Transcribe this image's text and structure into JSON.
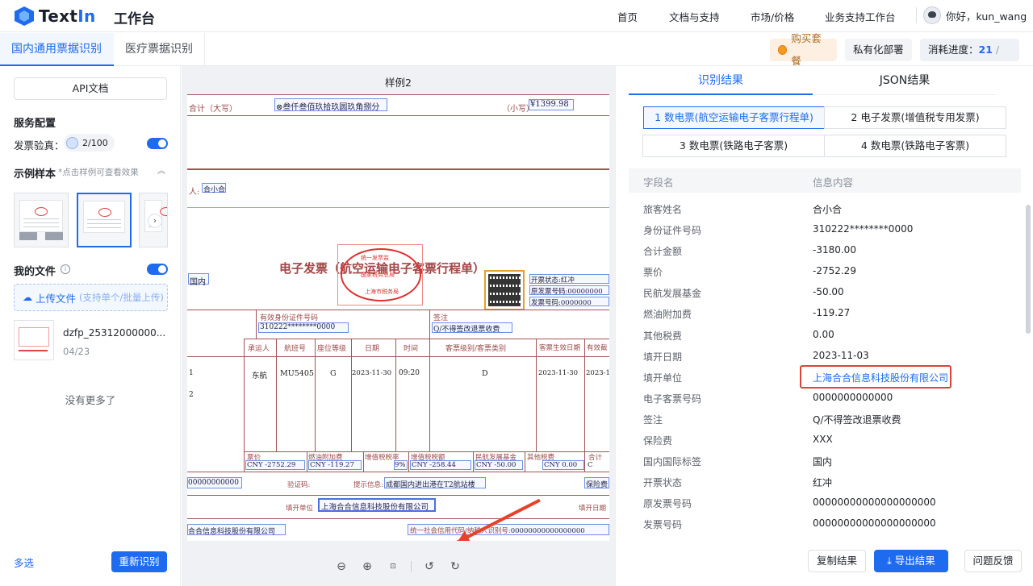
{
  "header": {
    "logo_text": "TextIn",
    "logo_text_main": "Text",
    "logo_text_accent": "In",
    "workbench": "工作台",
    "nav": [
      "首页",
      "文档与支持",
      "市场/价格",
      "业务支持工作台"
    ],
    "user_greeting": "你好，kun_wang"
  },
  "tabs": {
    "active": "国内通用票据识别",
    "second": "医疗票据识别",
    "buy_label": "购买套餐",
    "private_label": "私有化部署",
    "usage_label": "消耗进度：",
    "usage_used": "21",
    "usage_total": "/ 100"
  },
  "sidebar": {
    "api_doc": "API文档",
    "service_config": "服务配置",
    "invoice_verify": "发票验真：",
    "verify_quota": "2/100",
    "samples_title": "示例样本",
    "samples_hint": "*点击样例可查看效果",
    "my_files": "我的文件",
    "upload_main": "上传文件",
    "upload_sub": "(支持单个/批量上传)",
    "file_name": "dzfp_25312000000...",
    "file_date": "04/23",
    "no_more": "没有更多了",
    "multi_select": "多选",
    "reparse": "重新识别"
  },
  "preview": {
    "title": "样例2",
    "paper": {
      "total_upper_label": "合计（大写）",
      "total_upper_value": "叁仟叁佰玖拾玖圆玖角捌分",
      "total_lower_label": "（小写）",
      "total_lower_value": "¥1399.98",
      "passenger_prefix": "人:",
      "passenger": "合小合",
      "doc_title": "电子发票（航空运输电子客票行程单）",
      "domestic": "国内",
      "status_label": "开票状态:",
      "status": "红冲",
      "orig_no_label": "原发票号码:",
      "orig_no": "00000000",
      "inv_no_label": "发票号码:",
      "inv_no": "0000000",
      "id_label": "有效身份证件号码",
      "id_value": "310222********0000",
      "note_label": "签注",
      "note_value": "Q/不得签改退票收费",
      "cols": [
        "承运人",
        "航班号",
        "座位等级",
        "日期",
        "时间",
        "客票级别/客票类别",
        "客票生效日期",
        "有效截"
      ],
      "row1_idx": "1",
      "row2_idx": "2",
      "carrier": "东航",
      "flight": "MU5405",
      "seat": "G",
      "date": "2023-11-30",
      "time": "09:20",
      "fare_class": "D",
      "valid_date": "2023-11-30",
      "valid_end": "2023-1",
      "fee_cols": [
        "票价",
        "燃油附加费",
        "增值税税率",
        "增值税税额",
        "民航发展基金",
        "其他税费",
        "合计"
      ],
      "fare": "CNY -2752.29",
      "fuel": "CNY -119.27",
      "vat_rate": "9%",
      "vat": "CNY -258.44",
      "fund": "CNY -50.00",
      "other": "CNY 0.00",
      "total_short": "C",
      "eticket_no": "00000000000",
      "verify_code": "验证码:",
      "tip_label": "提示信息:",
      "tip": "成都国内进出港在T2航站楼",
      "insurance": "保险费",
      "issuer_label": "填开单位",
      "issuer": "上海合合信息科技股份有限公司",
      "issue_date_label": "填开日期",
      "buyer": "合合信息科技股份有限公司",
      "credit_label": "统一社会信用代码/纳税人识别号:",
      "credit_value": "00000000000000000",
      "stamp_lines": [
        "统一发票监",
        "国家税务总局",
        "上海市税务局"
      ]
    }
  },
  "results": {
    "tab_result": "识别结果",
    "tab_json": "JSON结果",
    "doc_tabs": [
      "1 数电票(航空运输电子客票行程单)",
      "2 电子发票(增值税专用发票)",
      "3 数电票(铁路电子客票)",
      "4 数电票(铁路电子客票)"
    ],
    "col_field": "字段名",
    "col_value": "信息内容",
    "rows": [
      {
        "k": "旅客姓名",
        "v": "合小合"
      },
      {
        "k": "身份证件号码",
        "v": "310222********0000"
      },
      {
        "k": "合计金额",
        "v": "-3180.00"
      },
      {
        "k": "票价",
        "v": "-2752.29"
      },
      {
        "k": "民航发展基金",
        "v": "-50.00"
      },
      {
        "k": "燃油附加费",
        "v": "-119.27"
      },
      {
        "k": "其他税费",
        "v": "0.00"
      },
      {
        "k": "填开日期",
        "v": "2023-11-03"
      },
      {
        "k": "填开单位",
        "v": "上海合合信息科技股份有限公司"
      },
      {
        "k": "电子客票号码",
        "v": "0000000000000"
      },
      {
        "k": "签注",
        "v": "Q/不得签改退票收费"
      },
      {
        "k": "保险费",
        "v": "XXX"
      },
      {
        "k": "国内国际标签",
        "v": "国内"
      },
      {
        "k": "开票状态",
        "v": "红冲"
      },
      {
        "k": "原发票号码",
        "v": "00000000000000000000"
      },
      {
        "k": "发票号码",
        "v": "00000000000000000000"
      }
    ],
    "copy_btn": "复制结果",
    "export_btn": "导出结果",
    "feedback_btn": "问题反馈"
  },
  "colors": {
    "accent": "#1e6bf0",
    "highlight_border": "#d9443c",
    "arrow": "#e8412a"
  }
}
